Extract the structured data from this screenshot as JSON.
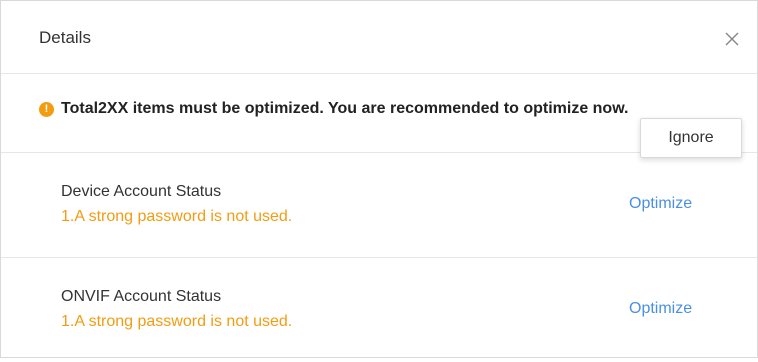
{
  "dialog": {
    "title": "Details",
    "close_icon": "close-icon"
  },
  "warning": {
    "icon": "exclamation-circle-icon",
    "icon_glyph": "!",
    "message": "Total2XX items must be optimized. You are recommended to optimize now.",
    "ignore_label": "Ignore",
    "color": "#f39c12"
  },
  "items": [
    {
      "title": "Device Account Status",
      "issue": "1.A strong password is not used.",
      "action_label": "Optimize"
    },
    {
      "title": "ONVIF Account Status",
      "issue": "1.A strong password is not used.",
      "action_label": "Optimize"
    }
  ],
  "colors": {
    "accent": "#4a90e2",
    "warning": "#f39c12",
    "divider": "#e6e6e6"
  }
}
